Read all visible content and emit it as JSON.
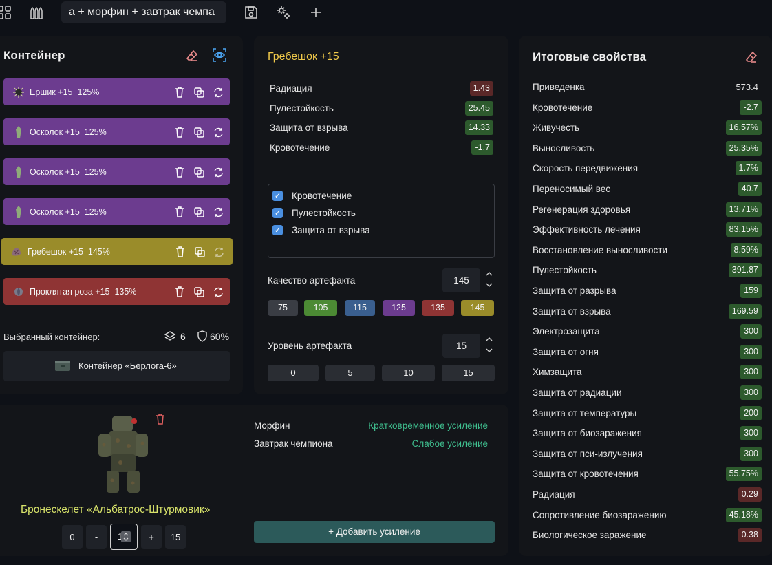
{
  "topbar": {
    "tab_title": "а + морфин + завтрак чемпа",
    "icons": [
      "grid-icon",
      "ammo-icon",
      "save-icon",
      "settings-icon",
      "plus-icon"
    ]
  },
  "container": {
    "title": "Контейнер",
    "artifacts": [
      {
        "name": "Ершик",
        "level": "+15",
        "quality": "125%",
        "color": "purple"
      },
      {
        "name": "Осколок",
        "level": "+15",
        "quality": "125%",
        "color": "purple"
      },
      {
        "name": "Осколок",
        "level": "+15",
        "quality": "125%",
        "color": "purple"
      },
      {
        "name": "Осколок",
        "level": "+15",
        "quality": "125%",
        "color": "purple"
      },
      {
        "name": "Гребешок",
        "level": "+15",
        "quality": "145%",
        "color": "gold"
      },
      {
        "name": "Проклятая роза",
        "level": "+15",
        "quality": "135%",
        "color": "red"
      }
    ],
    "selected_label": "Выбранный контейнер:",
    "slots": "6",
    "protection": "60%",
    "container_name": "Контейнер «Берлога-6»"
  },
  "artifact": {
    "title": "Гребешок +15",
    "stats": [
      {
        "label": "Радиация",
        "value": "1.43",
        "tone": "red"
      },
      {
        "label": "Пулестойкость",
        "value": "25.45",
        "tone": "green"
      },
      {
        "label": "Защита от взрыва",
        "value": "14.33",
        "tone": "green"
      },
      {
        "label": "Кровотечение",
        "value": "-1.7",
        "tone": "green"
      }
    ],
    "checks": [
      "Кровотечение",
      "Пулестойкость",
      "Защита от взрыва"
    ],
    "quality_label": "Качество артефакта",
    "quality_value": "145",
    "quality_presets": [
      "75",
      "105",
      "115",
      "125",
      "135",
      "145"
    ],
    "level_label": "Уровень артефакта",
    "level_value": "15",
    "level_presets": [
      "0",
      "5",
      "10",
      "15"
    ]
  },
  "armor": {
    "name": "Бронескелет «Альбатрос-Штурмовик»",
    "btn_zero": "0",
    "btn_minus": "-",
    "level_input": "1",
    "btn_plus": "+",
    "btn_max": "15",
    "boosts": [
      {
        "name": "Морфин",
        "effect": "Кратковременное усиление"
      },
      {
        "name": "Завтрак чемпиона",
        "effect": "Слабое усиление"
      }
    ],
    "add_boost_label": "+ Добавить усиление"
  },
  "totals": {
    "title": "Итоговые свойства",
    "rows": [
      {
        "label": "Приведенка",
        "value": "573.4",
        "tone": "plain"
      },
      {
        "label": "Кровотечение",
        "value": "-2.7",
        "tone": "green"
      },
      {
        "label": "Живучесть",
        "value": "16.57%",
        "tone": "green"
      },
      {
        "label": "Выносливость",
        "value": "25.35%",
        "tone": "green"
      },
      {
        "label": "Скорость передвижения",
        "value": "1.7%",
        "tone": "green"
      },
      {
        "label": "Переносимый вес",
        "value": "40.7",
        "tone": "green"
      },
      {
        "label": "Регенерация здоровья",
        "value": "13.71%",
        "tone": "green"
      },
      {
        "label": "Эффективность лечения",
        "value": "83.15%",
        "tone": "green"
      },
      {
        "label": "Восстановление выносливости",
        "value": "8.59%",
        "tone": "green"
      },
      {
        "label": "Пулестойкость",
        "value": "391.87",
        "tone": "green"
      },
      {
        "label": "Защита от разрыва",
        "value": "159",
        "tone": "green"
      },
      {
        "label": "Защита от взрыва",
        "value": "169.59",
        "tone": "green"
      },
      {
        "label": "Электрозащита",
        "value": "300",
        "tone": "green"
      },
      {
        "label": "Защита от огня",
        "value": "300",
        "tone": "green"
      },
      {
        "label": "Химзащита",
        "value": "300",
        "tone": "green"
      },
      {
        "label": "Защита от радиации",
        "value": "300",
        "tone": "green"
      },
      {
        "label": "Защита от температуры",
        "value": "200",
        "tone": "green"
      },
      {
        "label": "Защита от биозаражения",
        "value": "300",
        "tone": "green"
      },
      {
        "label": "Защита от пси-излучения",
        "value": "300",
        "tone": "green"
      },
      {
        "label": "Защита от кровотечения",
        "value": "55.75%",
        "tone": "green"
      },
      {
        "label": "Радиация",
        "value": "0.29",
        "tone": "red"
      },
      {
        "label": "Сопротивление биозаражению",
        "value": "45.18%",
        "tone": "green"
      },
      {
        "label": "Биологическое заражение",
        "value": "0.38",
        "tone": "red"
      }
    ]
  },
  "colors": {
    "purple": "#6c3c8f",
    "gold": "#9a8c2a",
    "red": "#8f3434",
    "title_gold": "#f0c94a",
    "armor_name": "#d8e36a",
    "boost_effect": "#3fbf8f",
    "add_button": "#2c5a5a",
    "preset_75": "#3a3d44",
    "preset_105": "#4c8a34",
    "preset_115": "#3a5f8f",
    "preset_125": "#6c3c8f",
    "preset_135": "#8f3434",
    "preset_145": "#9a8c2a"
  }
}
